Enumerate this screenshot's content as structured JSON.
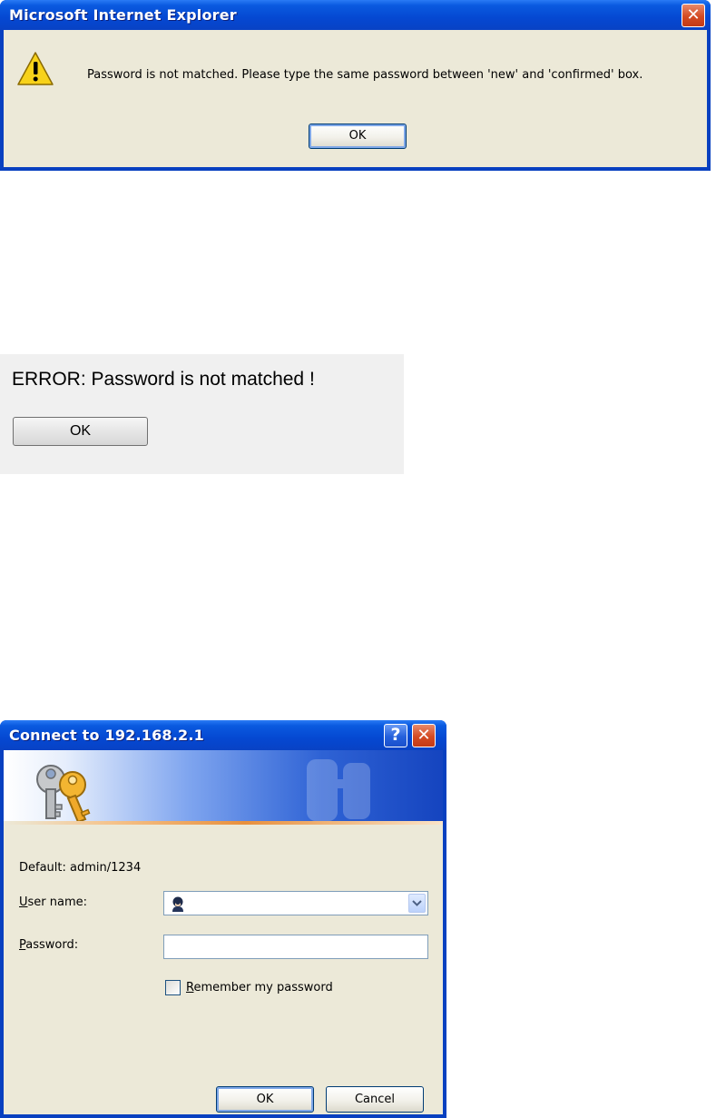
{
  "alert_dialog": {
    "title": "Microsoft Internet Explorer",
    "close_glyph": "✕",
    "icon": "warning-icon",
    "message": "Password is not matched. Please type the same password between 'new' and 'confirmed' box.",
    "ok_label": "OK"
  },
  "error_panel": {
    "message": "ERROR: Password is not matched !",
    "ok_label": "OK"
  },
  "login_dialog": {
    "title": "Connect to 192.168.2.1",
    "help_glyph": "?",
    "close_glyph": "✕",
    "banner_icon": "keys-icon",
    "default_text": "Default: admin/1234",
    "user_label_accel": "U",
    "user_label_rest": "ser name:",
    "user_value": "",
    "password_label_accel": "P",
    "password_label_rest": "assword:",
    "password_value": "",
    "remember_checked": false,
    "remember_label_accel": "R",
    "remember_label_rest": "emember my password",
    "ok_label": "OK",
    "cancel_label": "Cancel"
  },
  "colors": {
    "xp_titlebar": "#0548d2",
    "xp_face": "#ece9d8",
    "close_button": "#d44a22",
    "error_panel_bg": "#f0f0f0"
  }
}
